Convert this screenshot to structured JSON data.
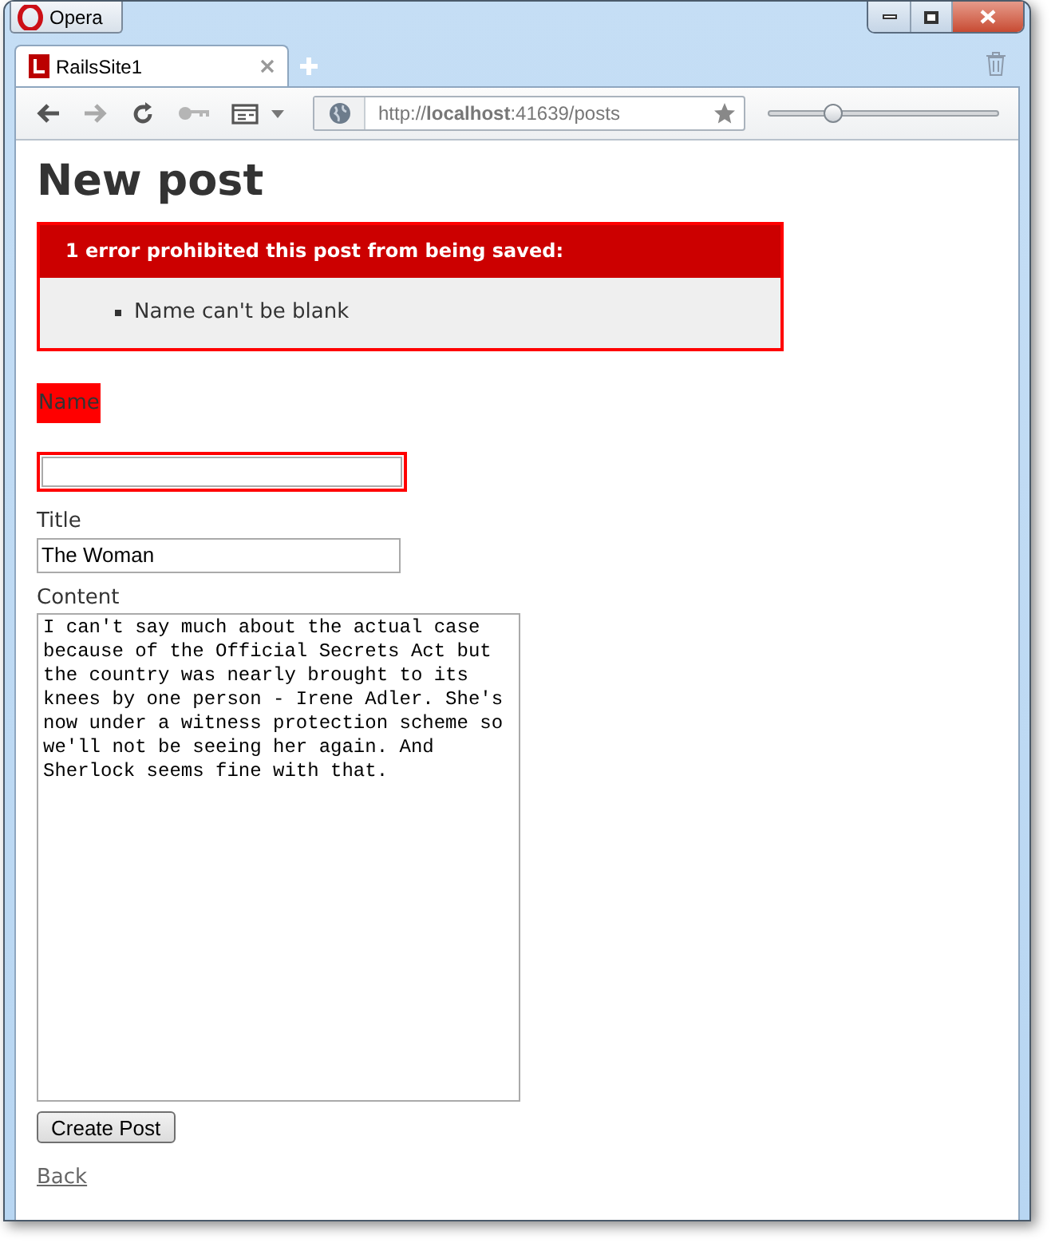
{
  "browser": {
    "menu_button": "Opera",
    "tabs": [
      {
        "title": "RailsSite1",
        "selected": true
      }
    ],
    "address": "http://**localhost**:41639/posts",
    "zoom": {
      "level": 0.28
    }
  },
  "page": {
    "heading": "New post",
    "errors": {
      "title": "1 error prohibited this post from being saved:",
      "messages": [
        "Name can't be blank"
      ]
    },
    "fields": [
      {
        "kind": "text",
        "label": "Name",
        "has_error": true
      },
      {
        "kind": "text",
        "label": "Title",
        "value": "The Woman",
        "has_error": false
      },
      {
        "kind": "textarea",
        "label": "Content",
        "value": "I can't say much about the actual case because of the Official Secrets Act but the country was nearly brought to its knees by one person - Irene Adler. She's now under a witness protection scheme so we'll not be seeing her again. And Sherlock seems fine with that.",
        "has_error": false
      }
    ],
    "submit": "Create Post",
    "back_link": "Back"
  }
}
